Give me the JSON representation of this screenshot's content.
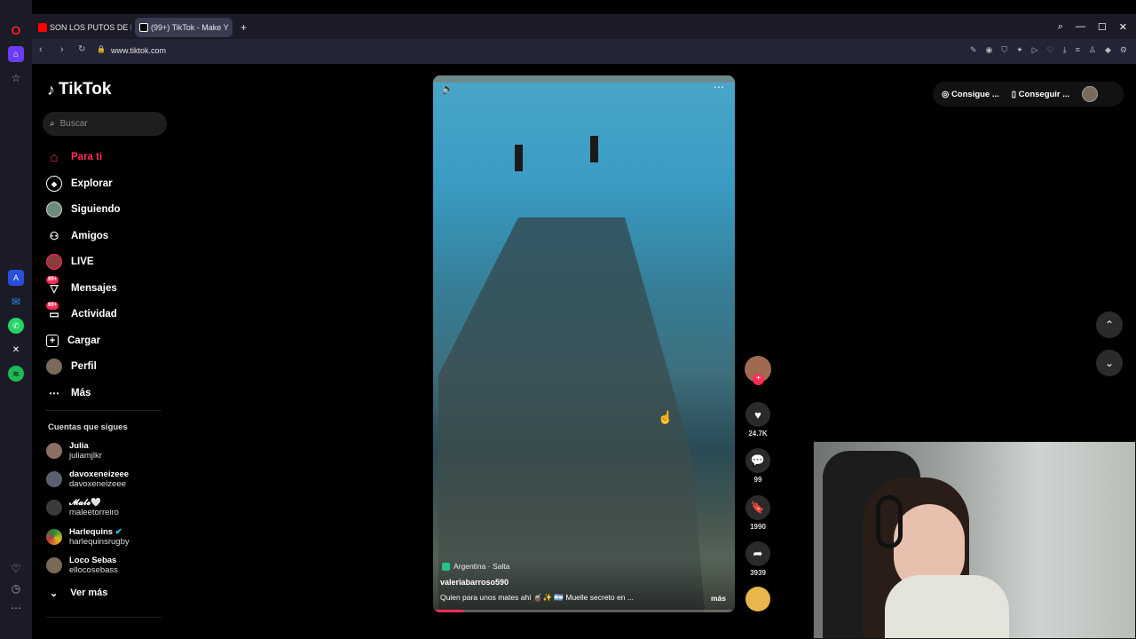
{
  "browser": {
    "tabs": [
      {
        "label": "SON LOS PUTOS DE RIBE"
      },
      {
        "label": "(99+) TikTok - Make Y"
      }
    ],
    "url": "www.tiktok.com"
  },
  "sidebar": {
    "logo": "TikTok",
    "search_placeholder": "Buscar",
    "nav": [
      {
        "label": "Para ti",
        "icon": "home-icon"
      },
      {
        "label": "Explorar",
        "icon": "compass-icon"
      },
      {
        "label": "Siguiendo",
        "icon": "avatar-icon"
      },
      {
        "label": "Amigos",
        "icon": "friends-icon"
      },
      {
        "label": "LIVE",
        "icon": "live-icon"
      },
      {
        "label": "Mensajes",
        "icon": "messages-icon",
        "badge": "99+"
      },
      {
        "label": "Actividad",
        "icon": "activity-icon",
        "badge": "99+"
      },
      {
        "label": "Cargar",
        "icon": "upload-icon"
      },
      {
        "label": "Perfil",
        "icon": "profile-icon"
      },
      {
        "label": "Más",
        "icon": "more-icon"
      }
    ],
    "following_title": "Cuentas que sigues",
    "following": [
      {
        "name": "Julia",
        "handle": "juliamjlkr"
      },
      {
        "name": "davoxeneizeee",
        "handle": "davoxeneizeee"
      },
      {
        "name": "𝓜𝓪𝓵𝓮🤍",
        "handle": "maleetorreiro"
      },
      {
        "name": "Harlequins",
        "handle": "harlequinsrugby"
      },
      {
        "name": "Loco Sebas",
        "handle": "ellocosebass"
      }
    ],
    "see_more": "Ver más"
  },
  "video": {
    "location": "Argentina · Salta",
    "username": "valeriabarroso590",
    "description": "Quien para unos mates ahí 🧉✨ 🇦🇷 Muelle secreto en ...",
    "more": "más",
    "progress": 0.1
  },
  "actions": {
    "likes": "24.7K",
    "comments": "99",
    "saves": "1990",
    "shares": "3939"
  },
  "topbar": {
    "get_coins": "Consigue ...",
    "get_app": "Conseguir ..."
  },
  "colors": {
    "accent": "#fe2c55",
    "background": "#000000",
    "browser": "#1a1b26"
  }
}
